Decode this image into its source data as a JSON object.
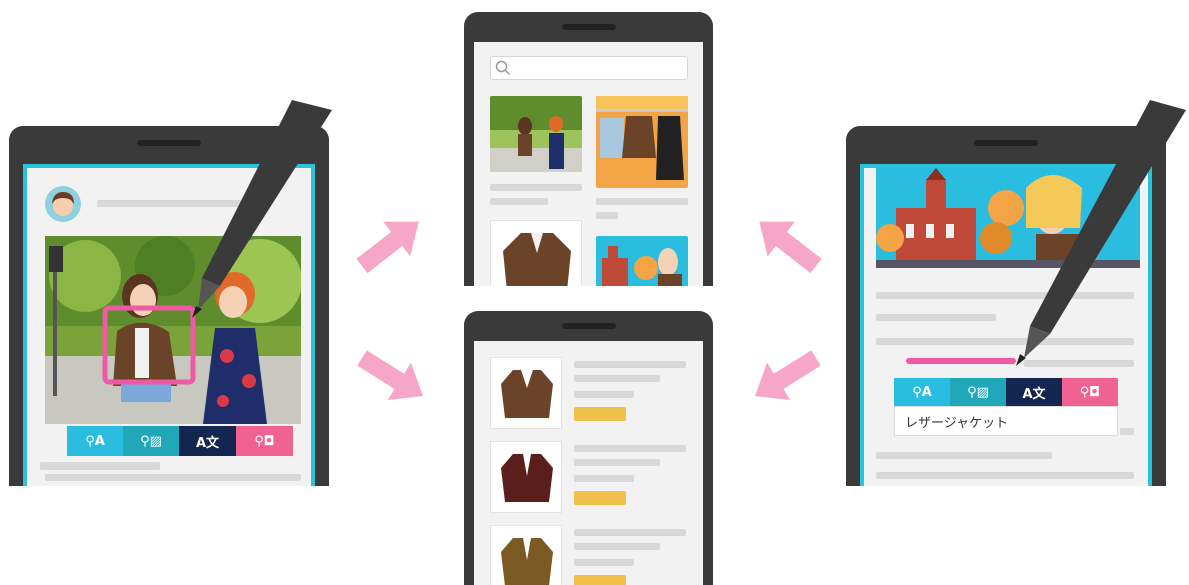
{
  "illustration": {
    "description_free": true,
    "colors": {
      "frame": "#3a3a3a",
      "screen_accent": "#27c4dc",
      "arrow": "#f6a7c8",
      "highlight": "#ee5aa4",
      "price_tag": "#f0c04a"
    }
  },
  "left_device": {
    "toolbar": [
      {
        "icon": "text-search-icon",
        "glyph": "⚲A",
        "color": "#2bbde0"
      },
      {
        "icon": "image-search-icon",
        "glyph": "⚲▨",
        "color": "#21a8b8"
      },
      {
        "icon": "translate-icon",
        "glyph": "A文",
        "color": "#13264f"
      },
      {
        "icon": "shopping-search-icon",
        "glyph": "⚲◘",
        "color": "#f06292"
      }
    ]
  },
  "right_device": {
    "toolbar": [
      {
        "icon": "text-search-icon",
        "glyph": "⚲A",
        "color": "#2bbde0"
      },
      {
        "icon": "image-search-icon",
        "glyph": "⚲▨",
        "color": "#21a8b8"
      },
      {
        "icon": "translate-icon",
        "glyph": "A文",
        "color": "#13264f"
      },
      {
        "icon": "shopping-search-icon",
        "glyph": "⚲◘",
        "color": "#f06292"
      }
    ],
    "result_text": "レザージャケット"
  },
  "search_device": {
    "search_placeholder": ""
  }
}
